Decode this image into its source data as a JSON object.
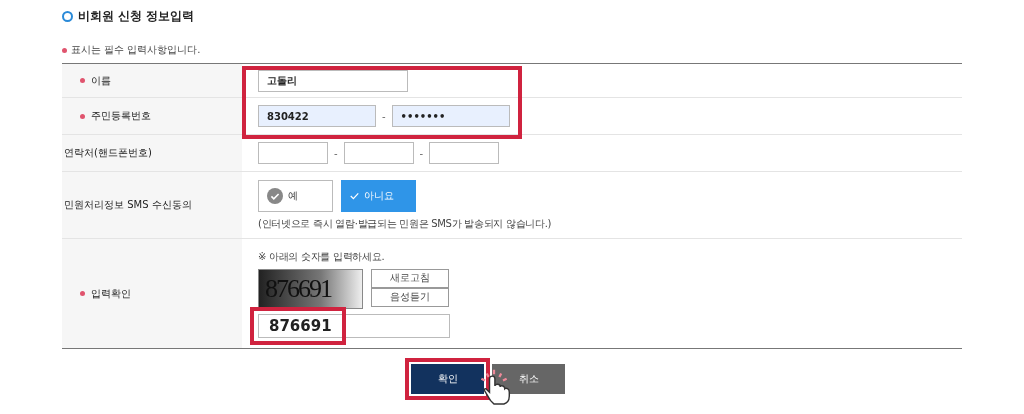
{
  "title": "비회원 신청 정보입력",
  "required_note": "표시는 필수 입력사항입니다.",
  "rows": [
    {
      "kind": "text",
      "label": "이름",
      "required": true,
      "fields": [
        {
          "value": "고돌리",
          "highlighted": false
        }
      ]
    },
    {
      "kind": "split",
      "label": "주민등록번호",
      "required": true,
      "fields": [
        {
          "value": "830422",
          "highlighted": true
        },
        {
          "value": "•••••••",
          "highlighted": true
        }
      ],
      "separators": [
        "-"
      ]
    },
    {
      "kind": "split",
      "label": "연락처(핸드폰번호)",
      "required": false,
      "fields": [
        {
          "highlighted": false
        },
        {
          "highlighted": false
        },
        {
          "highlighted": false
        }
      ],
      "separators": [
        "-",
        "-"
      ]
    },
    {
      "kind": "choice",
      "label": "민원처리정보 SMS 수신동의",
      "required": false,
      "options": [
        {
          "label": "예",
          "selected": false
        },
        {
          "label": "아니요",
          "selected": true
        }
      ],
      "note": "(인터넷으로 즉시 열람·발급되는 민원은 SMS가 발송되지 않습니다.)"
    },
    {
      "kind": "captcha",
      "label": "입력확인",
      "required": true,
      "instruction": "※ 아래의 숫자를 입력하세요.",
      "captcha_text": "876691",
      "buttons": [
        "새로고침",
        "음성듣기"
      ],
      "value": "876691"
    }
  ],
  "buttons": [
    {
      "label": "확인",
      "kind": "primary"
    },
    {
      "label": "취소",
      "kind": "secondary"
    }
  ]
}
